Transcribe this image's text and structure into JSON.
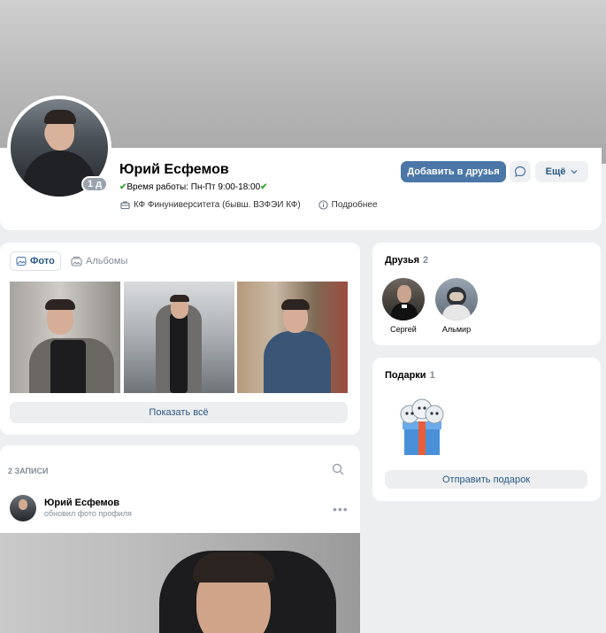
{
  "profile": {
    "name": "Юрий Есфемов",
    "online": "1 д",
    "status_text": "Время работы: Пн-Пт 9:00-18:00",
    "work_place": "КФ Финуниверситета (бывш. ВЗФЭИ КФ)",
    "more_info": "Подробнее",
    "actions": {
      "add_friend": "Добавить в друзья",
      "more": "Ещё"
    }
  },
  "photos": {
    "tab_photo": "Фото",
    "tab_albums": "Альбомы",
    "show_all": "Показать всё"
  },
  "friends": {
    "title": "Друзья",
    "count": "2",
    "items": [
      {
        "name": "Сергей"
      },
      {
        "name": "Альмир"
      }
    ]
  },
  "gifts": {
    "title": "Подарки",
    "count": "1",
    "send": "Отправить подарок"
  },
  "posts": {
    "count_label": "2 ЗАПИСИ",
    "post": {
      "author": "Юрий Есфемов",
      "action": "обновил фото профиля"
    }
  },
  "colors": {
    "accent": "#4a76a8",
    "link": "#2a5885",
    "page_bg": "#edeef0",
    "muted": "#818c99",
    "status_check": "#3aa63a"
  }
}
